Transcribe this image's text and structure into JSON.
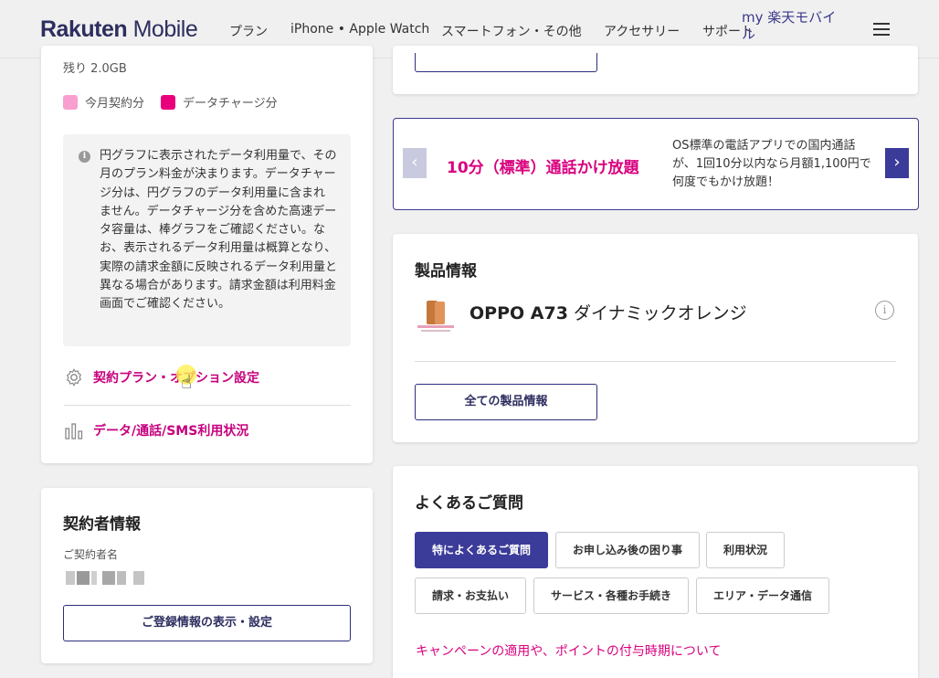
{
  "header": {
    "logo_text": "Rakuten",
    "logo_suffix": "Mobile",
    "nav": [
      "プラン",
      "iPhone • Apple Watch",
      "スマートフォン・その他",
      "アクセサリー",
      "サポート"
    ],
    "my_link": "my 楽天モバイル"
  },
  "usage": {
    "remaining": "残り 2.0GB",
    "legend": [
      {
        "label": "今月契約分",
        "color": "#f99fd0"
      },
      {
        "label": "データチャージ分",
        "color": "#e8007c"
      }
    ],
    "info_text": "円グラフに表示されたデータ利用量で、その月のプラン料金が決まります。データチャージ分は、円グラフのデータ利用量に含まれません。データチャージ分を含めた高速データ容量は、棒グラフをご確認ください。なお、表示されるデータ利用量は概算となり、実際の請求金額に反映されるデータ利用量と異なる場合があります。請求金額は利用料金画面でご確認ください。",
    "link_plan": "契約プラン・オプション設定",
    "link_usage": "データ/通話/SMS利用状況"
  },
  "contract": {
    "title": "契約者情報",
    "name_label": "ご契約者名",
    "button": "ご登録情報の表示・設定"
  },
  "promo": {
    "title": "10分（標準）通話かけ放題",
    "desc": "OS標準の電話アプリでの国内通話が、1回10分以内なら月額1,100円で何度でもかけ放題！",
    "prev_icon": "‹",
    "next_icon": "›"
  },
  "product": {
    "title": "製品情報",
    "name_bold": "OPPO A73",
    "name_rest": " ダイナミックオレンジ",
    "button": "全ての製品情報"
  },
  "faq": {
    "title": "よくあるご質問",
    "chips": [
      "特によくあるご質問",
      "お申し込み後の困り事",
      "利用状況",
      "請求・お支払い",
      "サービス・各種お手続き",
      "エリア・データ通信"
    ],
    "link": "キャンペーンの適用や、ポイントの付与時期について"
  },
  "colors": {
    "brand_navy": "#2d2e5f",
    "accent_magenta": "#d9007e",
    "button_navy": "#3b3b9a"
  }
}
